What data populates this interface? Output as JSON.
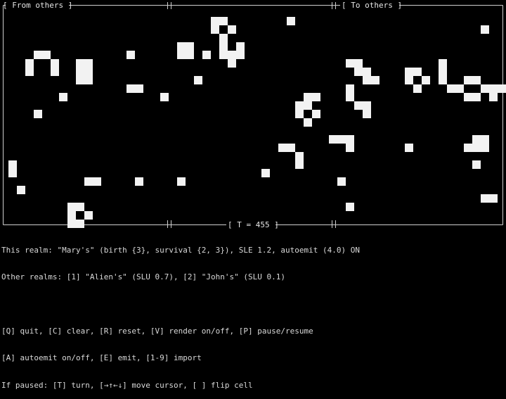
{
  "panels": {
    "from_others_label": "[ From others ]",
    "to_others_label": "[ To others ]",
    "timer_label": "[ T = 455 ]"
  },
  "status": {
    "this_realm": "This realm: \"Mary's\" (birth {3}, survival {2, 3}), SLE 1.2, autoemit (4.0) ON",
    "other_realms": "Other realms: [1] \"Alien's\" (SLU 0.7), [2] \"John's\" (SLU 0.1)"
  },
  "help": {
    "line1": "[Q] quit, [C] clear, [R] reset, [V] render on/off, [P] pause/resume",
    "line2": "[A] autoemit on/off, [E] emit, [1-9] import",
    "line3": "If paused: [T] turn, [→↑←↓] move cursor, [ ] flip cell"
  },
  "colors": {
    "background": "#000000",
    "cell": "#f2f2f2",
    "frame": "#cfcfcf",
    "text": "#d9d9d9"
  }
}
